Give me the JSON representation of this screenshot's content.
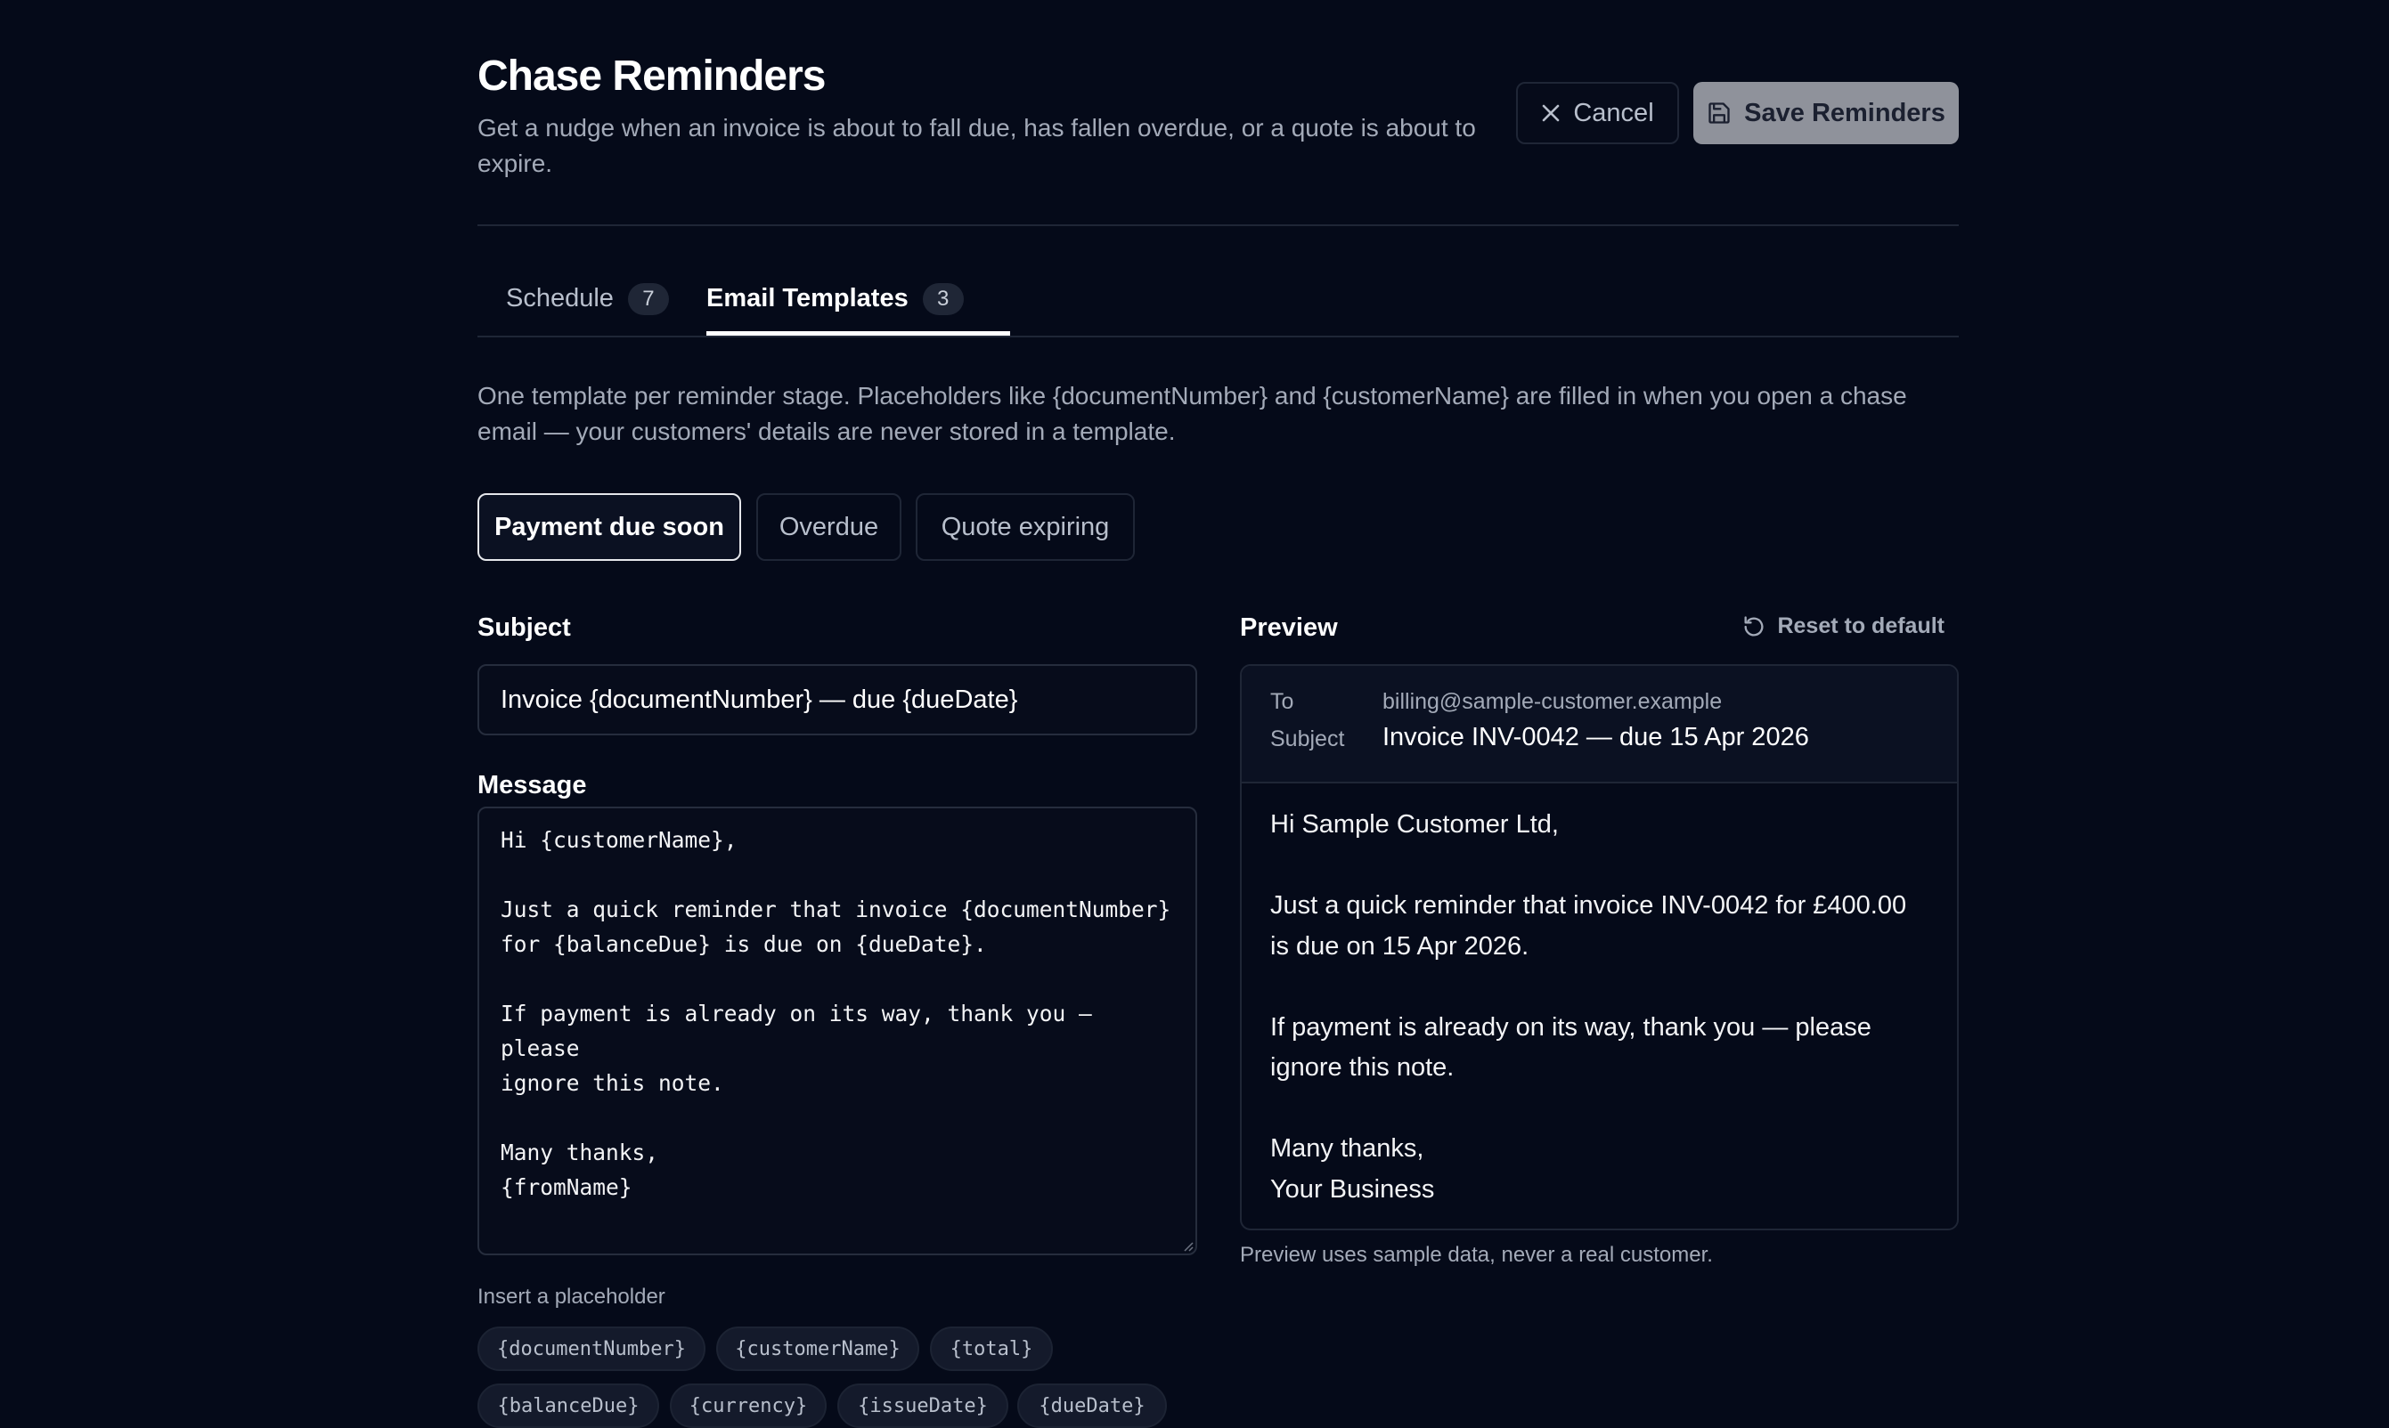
{
  "header": {
    "title": "Chase Reminders",
    "subtitle": "Get a nudge when an invoice is about to fall due, has fallen overdue, or a quote is about to expire.",
    "cancel_label": "Cancel",
    "save_label": "Save Reminders"
  },
  "tabs": [
    {
      "label": "Schedule",
      "count": "7",
      "active": false
    },
    {
      "label": "Email Templates",
      "count": "3",
      "active": true
    }
  ],
  "intro": "One template per reminder stage. Placeholders like {documentNumber} and {customerName} are filled in when you open a chase email — your customers' details are never stored in a template.",
  "stages": [
    {
      "label": "Payment due soon",
      "active": true
    },
    {
      "label": "Overdue",
      "active": false
    },
    {
      "label": "Quote expiring",
      "active": false
    }
  ],
  "editor": {
    "subject_label": "Subject",
    "subject_value": "Invoice {documentNumber} — due {dueDate}",
    "message_label": "Message",
    "message_value": "Hi {customerName},\n\nJust a quick reminder that invoice {documentNumber}\nfor {balanceDue} is due on {dueDate}.\n\nIf payment is already on its way, thank you — please\nignore this note.\n\nMany thanks,\n{fromName}",
    "placeholder_label": "Insert a placeholder",
    "placeholders": [
      "{documentNumber}",
      "{customerName}",
      "{total}",
      "{balanceDue}",
      "{currency}",
      "{issueDate}",
      "{dueDate}"
    ]
  },
  "preview": {
    "label": "Preview",
    "reset_label": "Reset to default",
    "to_key": "To",
    "to_value": "billing@sample-customer.example",
    "subject_key": "Subject",
    "subject_value": "Invoice INV-0042 — due 15 Apr 2026",
    "body": "Hi Sample Customer Ltd,\n\nJust a quick reminder that invoice INV-0042 for £400.00\nis due on 15 Apr 2026.\n\nIf payment is already on its way, thank you — please\nignore this note.\n\nMany thanks,\nYour Business",
    "note": "Preview uses sample data, never a real customer."
  },
  "icons": {
    "cancel": "close-icon",
    "save": "floppy-disk-icon",
    "reset": "rotate-ccw-icon"
  }
}
